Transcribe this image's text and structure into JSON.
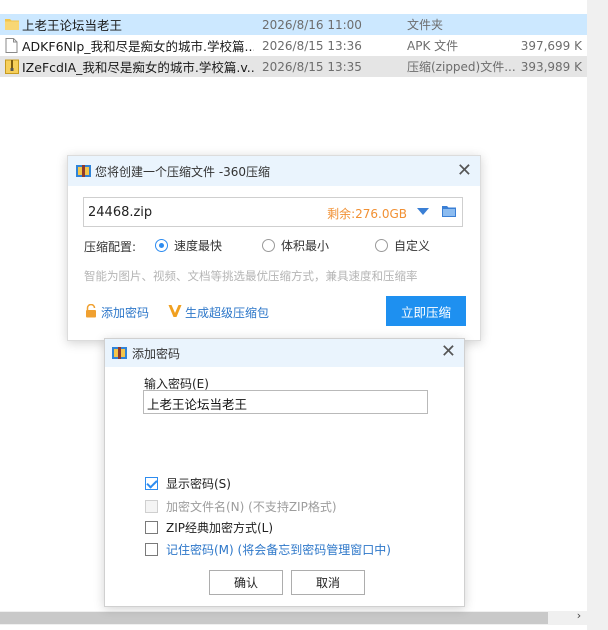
{
  "files": [
    {
      "name": "上老王论坛当老王",
      "date": "2026/8/16 11:00",
      "type": "文件夹",
      "size": "",
      "icon": "folder-icon"
    },
    {
      "name": "ADKF6Nlp_我和尽是痴女的城市.学校篇....",
      "date": "2026/8/15 13:36",
      "type": "APK 文件",
      "size": "397,699 K",
      "icon": "file-icon"
    },
    {
      "name": "IZeFcdIA_我和尽是痴女的城市.学校篇.v...",
      "date": "2026/8/15 13:35",
      "type": "压缩(zipped)文件...",
      "size": "393,989 K",
      "icon": "zip-icon"
    }
  ],
  "compress_dialog": {
    "title": "您将创建一个压缩文件 -360压缩",
    "path": "24468.zip",
    "free_space": "剩余:276.0GB",
    "config_label": "压缩配置:",
    "options": [
      "速度最快",
      "体积最小",
      "自定义"
    ],
    "selected_option": "速度最快",
    "hint": "智能为图片、视频、文档等挑选最优压缩方式，兼具速度和压缩率",
    "add_password": "添加密码",
    "super_package": "生成超级压缩包",
    "compress_button": "立即压缩",
    "accent_color": "#1e90f0"
  },
  "password_dialog": {
    "title": "添加密码",
    "input_label": "输入密码(E)",
    "password_value": "上老王论坛当老王",
    "options": [
      {
        "label": "显示密码(S)",
        "checked": true,
        "disabled": false
      },
      {
        "label": "加密文件名(N) (不支持ZIP格式)",
        "checked": false,
        "disabled": true
      },
      {
        "label": "ZIP经典加密方式(L)",
        "checked": false,
        "disabled": false
      },
      {
        "label": "记住密码(M) (将会备忘到密码管理窗口中)",
        "checked": false,
        "disabled": false
      }
    ],
    "ok_button": "确认",
    "cancel_button": "取消"
  }
}
